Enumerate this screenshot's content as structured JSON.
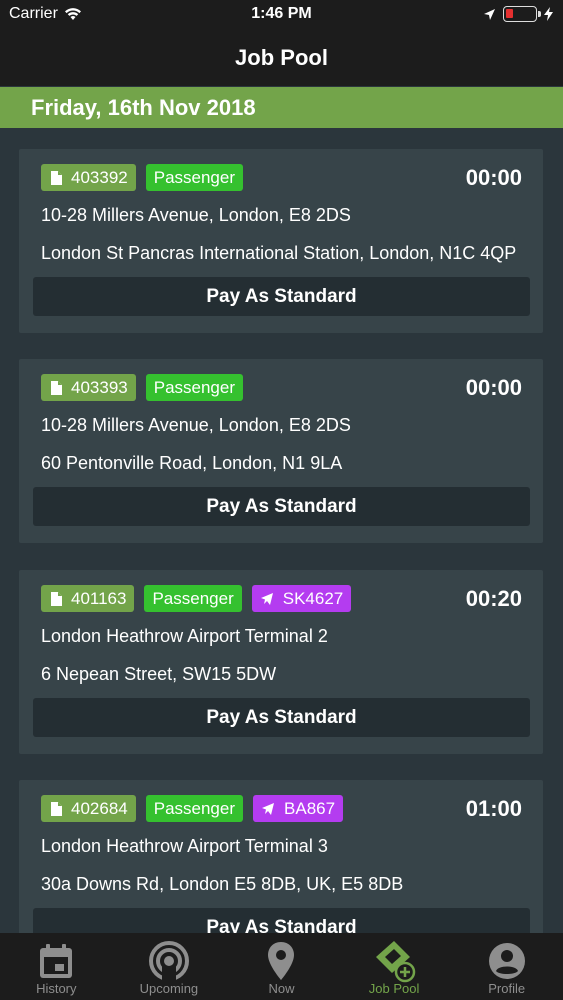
{
  "status_bar": {
    "carrier": "Carrier",
    "time": "1:46 PM"
  },
  "header": {
    "title": "Job Pool"
  },
  "date_header": "Friday, 16th Nov 2018",
  "jobs": [
    {
      "job_id": "403392",
      "type": "Passenger",
      "flight": "",
      "time": "00:00",
      "pickup": "10-28 Millers Avenue, London, E8 2DS",
      "dropoff": " London St Pancras International Station, London, N1C 4QP",
      "pay": "Pay As Standard"
    },
    {
      "job_id": "403393",
      "type": "Passenger",
      "flight": "",
      "time": "00:00",
      "pickup": "10-28 Millers Avenue, London, E8 2DS",
      "dropoff": "60 Pentonville Road, London, N1 9LA",
      "pay": "Pay As Standard"
    },
    {
      "job_id": "401163",
      "type": "Passenger",
      "flight": "SK4627",
      "time": "00:20",
      "pickup": "London Heathrow Airport Terminal 2",
      "dropoff": "6 Nepean Street, SW15 5DW",
      "pay": "Pay As Standard"
    },
    {
      "job_id": "402684",
      "type": "Passenger",
      "flight": "BA867",
      "time": "01:00",
      "pickup": "London Heathrow Airport Terminal 3",
      "dropoff": " 30a Downs Rd, London E5 8DB, UK, E5 8DB",
      "pay": "Pay As Standard"
    }
  ],
  "tabs": [
    {
      "label": "History",
      "icon": "calendar-icon"
    },
    {
      "label": "Upcoming",
      "icon": "broadcast-icon"
    },
    {
      "label": "Now",
      "icon": "map-pin-icon"
    },
    {
      "label": "Job Pool",
      "icon": "ticket-add-icon",
      "active": true
    },
    {
      "label": "Profile",
      "icon": "profile-icon"
    }
  ],
  "colors": {
    "accent": "#73a44a",
    "passenger": "#35c12f",
    "flight": "#b43cf0",
    "battery": "#e53030"
  }
}
